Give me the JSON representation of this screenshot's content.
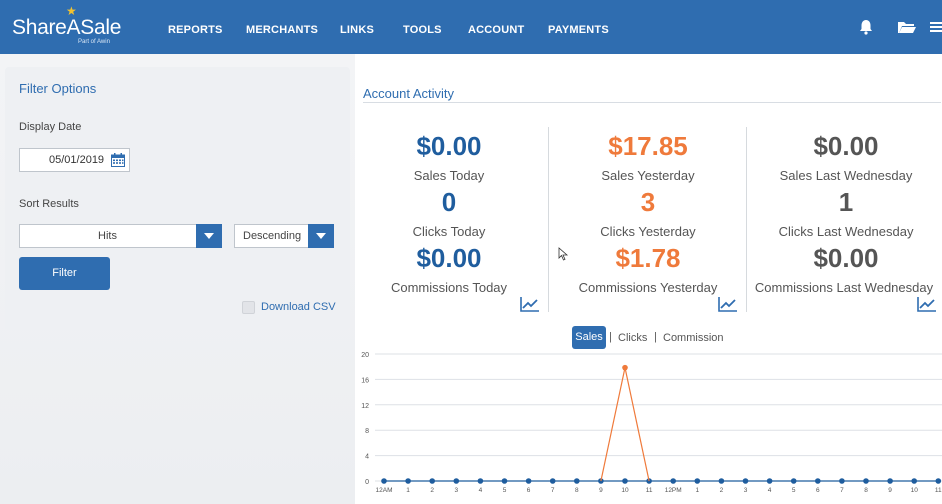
{
  "header": {
    "logo_text": "ShareASale",
    "logo_sub": "Part of Awin",
    "nav": [
      "REPORTS",
      "MERCHANTS",
      "LINKS",
      "TOOLS",
      "ACCOUNT",
      "PAYMENTS"
    ],
    "icons": [
      "bell-icon",
      "folder-icon",
      "menu-icon"
    ]
  },
  "filter": {
    "title": "Filter Options",
    "display_date_label": "Display Date",
    "date_value": "05/01/2019",
    "sort_label": "Sort Results",
    "sort_field": "Hits",
    "sort_order": "Descending",
    "filter_button": "Filter",
    "download_csv": "Download CSV"
  },
  "activity": {
    "title": "Account Activity",
    "columns": [
      {
        "sales": "$0.00",
        "sales_label": "Sales Today",
        "clicks": "0",
        "clicks_label": "Clicks Today",
        "commissions": "$0.00",
        "commissions_label": "Commissions Today",
        "color": "#1f5d9e"
      },
      {
        "sales": "$17.85",
        "sales_label": "Sales Yesterday",
        "clicks": "3",
        "clicks_label": "Clicks Yesterday",
        "commissions": "$1.78",
        "commissions_label": "Commissions Yesterday",
        "color": "#ef7a3b"
      },
      {
        "sales": "$0.00",
        "sales_label": "Sales Last Wednesday",
        "clicks": "1",
        "clicks_label": "Clicks Last Wednesday",
        "commissions": "$0.00",
        "commissions_label": "Commissions Last Wednesday",
        "color": "#555555"
      }
    ]
  },
  "tabs": {
    "sales": "Sales",
    "clicks": "Clicks",
    "commission": "Commission",
    "separator": "|"
  },
  "chart_data": {
    "type": "line",
    "categories": [
      "12AM",
      "1",
      "2",
      "3",
      "4",
      "5",
      "6",
      "7",
      "8",
      "9",
      "10",
      "11",
      "12PM",
      "1",
      "2",
      "3",
      "4",
      "5",
      "6",
      "7",
      "8",
      "9",
      "10",
      "11"
    ],
    "series": [
      {
        "values": [
          0,
          0,
          0,
          0,
          0,
          0,
          0,
          0,
          0,
          0,
          0,
          0,
          0,
          0,
          0,
          0,
          0,
          0,
          0,
          0,
          0,
          0,
          0,
          0
        ],
        "color": "#1f5d9e"
      },
      {
        "values": [
          null,
          null,
          null,
          null,
          null,
          null,
          null,
          null,
          null,
          0,
          17.85,
          0,
          null,
          null,
          null,
          null,
          null,
          null,
          null,
          null,
          null,
          null,
          null,
          null
        ],
        "color": "#ef7a3b"
      }
    ],
    "yticks": [
      0,
      4,
      8,
      12,
      16,
      20
    ],
    "ylim": [
      0,
      20
    ],
    "grid": true
  }
}
